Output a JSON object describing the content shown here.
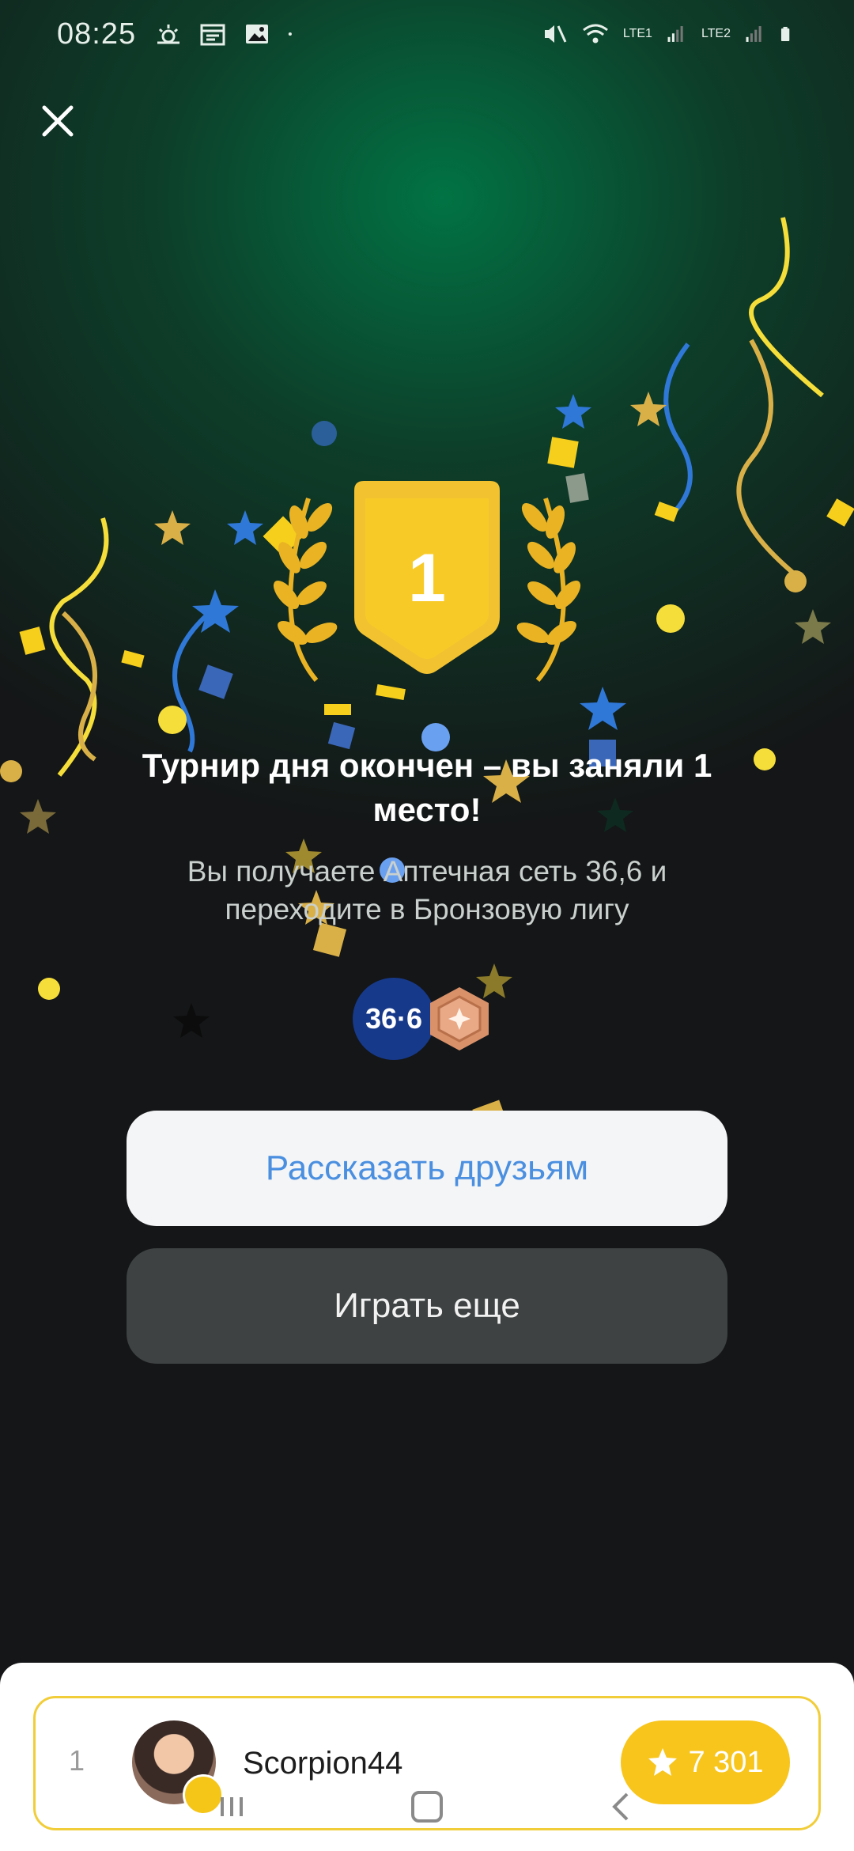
{
  "status_bar": {
    "time": "08:25",
    "sim1": "LTE1",
    "sim2": "LTE2",
    "icons": [
      "weather-icon",
      "calendar-icon",
      "gallery-icon",
      "dot-icon",
      "mute-vibrate-icon",
      "wifi-icon",
      "signal-icon",
      "battery-icon"
    ]
  },
  "result": {
    "place_number": "1",
    "title": "Турнир дня окончен – вы заняли 1 место!",
    "subtitle": "Вы получаете Аптечная сеть 36,6 и переходите в Бронзовую лигу",
    "reward_brand": "36·6",
    "league_icon": "bronze-league-icon"
  },
  "buttons": {
    "share": "Рассказать друзьям",
    "play_again": "Играть еще"
  },
  "leaderboard": {
    "rank": "1",
    "username": "Scorpion44",
    "score": "7 301"
  },
  "colors": {
    "accent_gold": "#F8C51D",
    "share_text": "#4A8FE0",
    "bronze": "#D9916A",
    "brand_blue": "#17398A"
  }
}
